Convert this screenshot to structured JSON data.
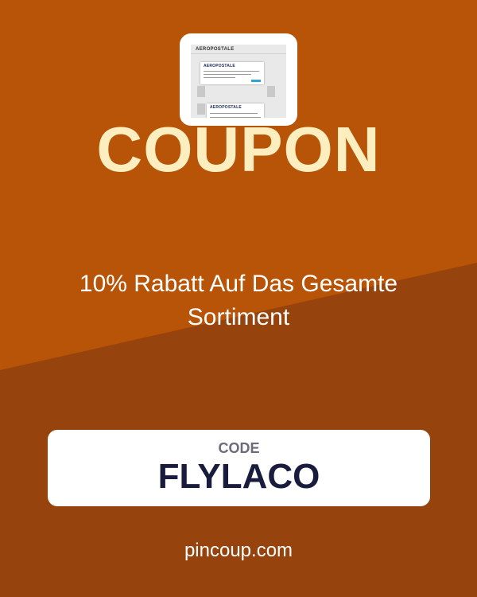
{
  "colors": {
    "background_top": "#b75408",
    "background_bottom": "#96430d",
    "title": "#fdeec0",
    "code_text": "#1a1c3d",
    "code_label": "#6b6b7b"
  },
  "thumbnail": {
    "brand_logo": "AEROPOSTALE"
  },
  "title": "COUPON",
  "description": "10% Rabatt Auf Das Gesamte Sortiment",
  "code": {
    "label": "CODE",
    "value": "FLYLACO"
  },
  "site": "pincoup.com"
}
